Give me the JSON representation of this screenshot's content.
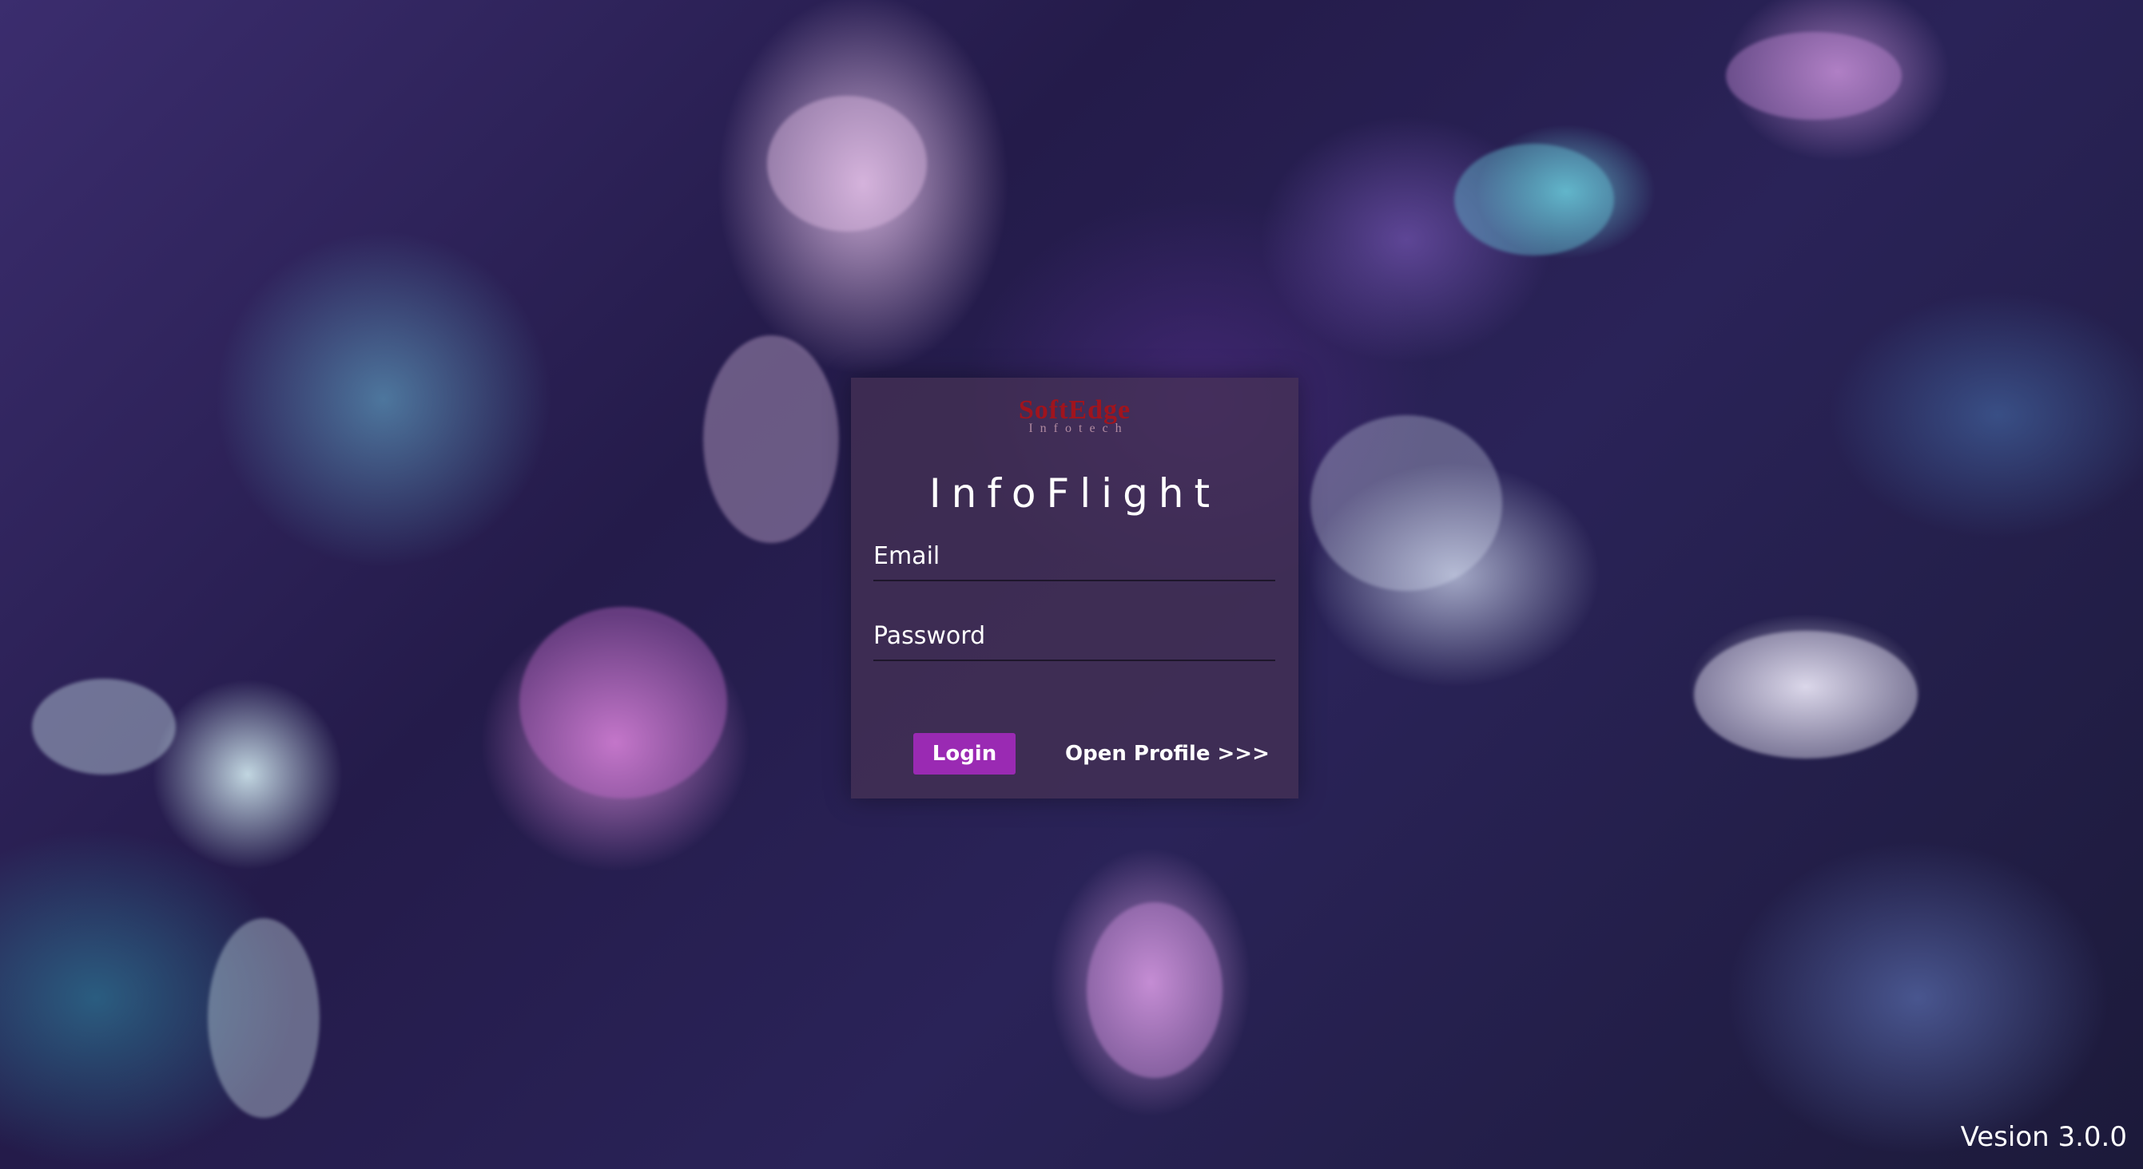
{
  "logo": {
    "name": "SoftEdge",
    "tagline": "Infotech"
  },
  "app": {
    "title": "InfoFlight"
  },
  "form": {
    "email_placeholder": "Email",
    "email_value": "",
    "password_placeholder": "Password",
    "password_value": ""
  },
  "actions": {
    "login_label": "Login",
    "open_profile_label": "Open Profile >>>"
  },
  "footer": {
    "version_text": "Vesion 3.0.0"
  },
  "colors": {
    "login_button": "#9a2ab3",
    "logo_red": "#a0141d",
    "card_background": "rgba(70,50,85,0.72)"
  }
}
